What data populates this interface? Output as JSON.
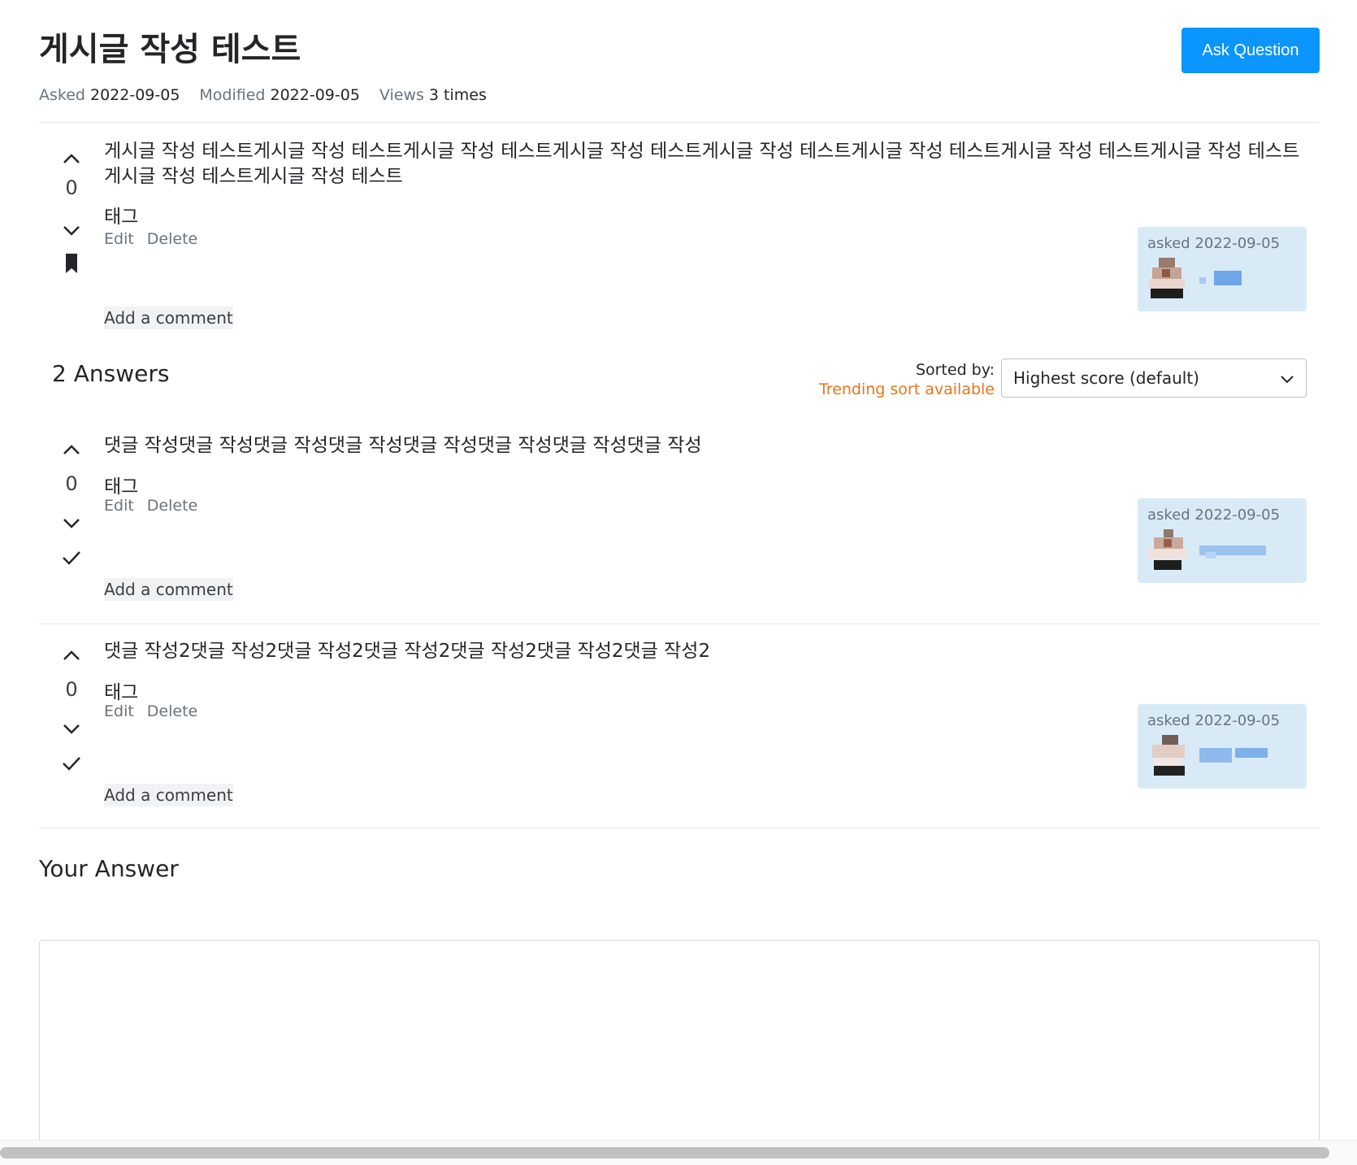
{
  "question": {
    "title": "게시글 작성 테스트",
    "ask_button": "Ask Question",
    "meta": {
      "asked_label": "Asked",
      "asked_value": "2022-09-05",
      "modified_label": "Modified",
      "modified_value": "2022-09-05",
      "views_label": "Views",
      "views_value": "3 times"
    },
    "vote_count": "0",
    "body": "게시글 작성 테스트게시글 작성 테스트게시글 작성 테스트게시글 작성 테스트게시글 작성 테스트게시글 작성 테스트게시글 작성 테스트게시글 작성 테스트게시글 작성 테스트게시글 작성 테스트",
    "tag": "태그",
    "edit_label": "Edit",
    "delete_label": "Delete",
    "add_comment": "Add a comment",
    "card_asked": "asked 2022-09-05"
  },
  "answers_header": {
    "title": "2 Answers",
    "sorted_by_label": "Sorted by:",
    "trending_label": "Trending sort available",
    "sort_value": "Highest score (default)"
  },
  "answers": [
    {
      "vote_count": "0",
      "body": "댓글 작성댓글 작성댓글 작성댓글 작성댓글 작성댓글 작성댓글 작성댓글 작성",
      "tag": "태그",
      "edit_label": "Edit",
      "delete_label": "Delete",
      "add_comment": "Add a comment",
      "card_asked": "asked 2022-09-05"
    },
    {
      "vote_count": "0",
      "body": "댓글 작성2댓글 작성2댓글 작성2댓글 작성2댓글 작성2댓글 작성2댓글 작성2",
      "tag": "태그",
      "edit_label": "Edit",
      "delete_label": "Delete",
      "add_comment": "Add a comment",
      "card_asked": "asked 2022-09-05"
    }
  ],
  "your_answer": {
    "title": "Your Answer"
  },
  "colors": {
    "primary": "#0a95ff",
    "trending": "#e8751a",
    "user_card_bg": "#d9eaf7",
    "muted": "#6a737c"
  },
  "icons": {
    "upvote": "chevron-up-icon",
    "downvote": "chevron-down-icon",
    "bookmark": "bookmark-icon",
    "accept": "checkmark-icon",
    "select": "chevron-down-icon"
  }
}
